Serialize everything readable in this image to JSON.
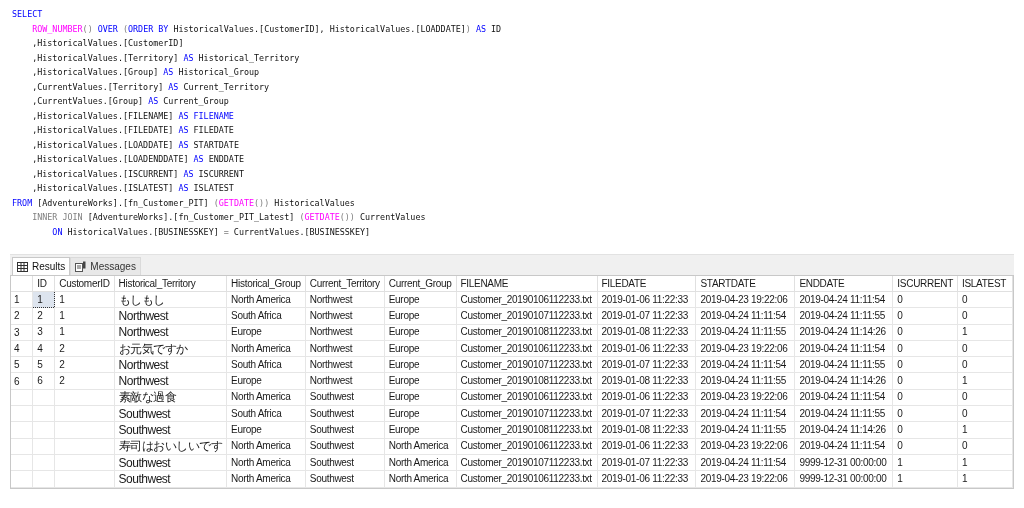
{
  "editor": {
    "lines": [
      [
        {
          "kind": "keyword",
          "text": "SELECT"
        }
      ],
      [
        {
          "kind": "function",
          "text": "    ROW_NUMBER"
        },
        {
          "kind": "operator",
          "text": "() "
        },
        {
          "kind": "keyword",
          "text": "OVER "
        },
        {
          "kind": "operator",
          "text": "("
        },
        {
          "kind": "keyword",
          "text": "ORDER BY"
        },
        {
          "kind": "plain",
          "text": " HistoricalValues.[CustomerID], HistoricalValues.[LOADDATE]"
        },
        {
          "kind": "operator",
          "text": ") "
        },
        {
          "kind": "keyword",
          "text": "AS"
        },
        {
          "kind": "plain",
          "text": " ID"
        }
      ],
      [
        {
          "kind": "plain",
          "text": "    ,HistoricalValues.[CustomerID]"
        }
      ],
      [
        {
          "kind": "plain",
          "text": "    ,HistoricalValues.[Territory] "
        },
        {
          "kind": "keyword",
          "text": "AS"
        },
        {
          "kind": "plain",
          "text": " Historical_Territory"
        }
      ],
      [
        {
          "kind": "plain",
          "text": "    ,HistoricalValues.[Group] "
        },
        {
          "kind": "keyword",
          "text": "AS"
        },
        {
          "kind": "plain",
          "text": " Historical_Group"
        }
      ],
      [
        {
          "kind": "plain",
          "text": "    ,CurrentValues.[Territory] "
        },
        {
          "kind": "keyword",
          "text": "AS"
        },
        {
          "kind": "plain",
          "text": " Current_Territory"
        }
      ],
      [
        {
          "kind": "plain",
          "text": "    ,CurrentValues.[Group] "
        },
        {
          "kind": "keyword",
          "text": "AS"
        },
        {
          "kind": "plain",
          "text": " Current_Group"
        }
      ],
      [
        {
          "kind": "plain",
          "text": "    ,HistoricalValues.[FILENAME] "
        },
        {
          "kind": "keyword",
          "text": "AS FILENAME"
        }
      ],
      [
        {
          "kind": "plain",
          "text": "    ,HistoricalValues.[FILEDATE] "
        },
        {
          "kind": "keyword",
          "text": "AS"
        },
        {
          "kind": "plain",
          "text": " FILEDATE"
        }
      ],
      [
        {
          "kind": "plain",
          "text": "    ,HistoricalValues.[LOADDATE] "
        },
        {
          "kind": "keyword",
          "text": "AS"
        },
        {
          "kind": "plain",
          "text": " STARTDATE"
        }
      ],
      [
        {
          "kind": "plain",
          "text": "    ,HistoricalValues.[LOADENDDATE] "
        },
        {
          "kind": "keyword",
          "text": "AS"
        },
        {
          "kind": "plain",
          "text": " ENDDATE"
        }
      ],
      [
        {
          "kind": "plain",
          "text": "    ,HistoricalValues.[ISCURRENT] "
        },
        {
          "kind": "keyword",
          "text": "AS"
        },
        {
          "kind": "plain",
          "text": " ISCURRENT"
        }
      ],
      [
        {
          "kind": "plain",
          "text": "    ,HistoricalValues.[ISLATEST] "
        },
        {
          "kind": "keyword",
          "text": "AS"
        },
        {
          "kind": "plain",
          "text": " ISLATEST"
        }
      ],
      [
        {
          "kind": "keyword",
          "text": "FROM"
        },
        {
          "kind": "plain",
          "text": " [AdventureWorks].[fn_Customer_PIT] "
        },
        {
          "kind": "operator",
          "text": "("
        },
        {
          "kind": "function",
          "text": "GETDATE"
        },
        {
          "kind": "operator",
          "text": "())"
        },
        {
          "kind": "plain",
          "text": " HistoricalValues"
        }
      ],
      [
        {
          "kind": "operator",
          "text": "    INNER JOIN"
        },
        {
          "kind": "plain",
          "text": " [AdventureWorks].[fn_Customer_PIT_Latest] "
        },
        {
          "kind": "operator",
          "text": "("
        },
        {
          "kind": "function",
          "text": "GETDATE"
        },
        {
          "kind": "operator",
          "text": "())"
        },
        {
          "kind": "plain",
          "text": " CurrentValues"
        }
      ],
      [
        {
          "kind": "keyword",
          "text": "        ON"
        },
        {
          "kind": "plain",
          "text": " HistoricalValues.[BUSINESSKEY] "
        },
        {
          "kind": "operator",
          "text": "="
        },
        {
          "kind": "plain",
          "text": " CurrentValues.[BUSINESSKEY]"
        }
      ]
    ]
  },
  "results": {
    "tabs": [
      {
        "label": "Results",
        "selected": true
      },
      {
        "label": "Messages",
        "selected": false
      }
    ],
    "columns": [
      "ID",
      "CustomerID",
      "Historical_Territory",
      "Historical_Group",
      "Current_Territory",
      "Current_Group",
      "FILENAME",
      "FILEDATE",
      "STARTDATE",
      "ENDDATE",
      "ISCURRENT",
      "ISLATEST"
    ],
    "rows": [
      {
        "row_number": "1",
        "selected": true,
        "cells": [
          "1",
          "1",
          "もしもし",
          "North America",
          "Northwest",
          "Europe",
          "Customer_20190106112233.txt",
          "2019-01-06 11:22:33",
          "2019-04-23 19:22:06",
          "2019-04-24 11:11:54",
          "0",
          "0"
        ]
      },
      {
        "row_number": "2",
        "selected": false,
        "cells": [
          "2",
          "1",
          "Northwest",
          "South Africa",
          "Northwest",
          "Europe",
          "Customer_20190107112233.txt",
          "2019-01-07 11:22:33",
          "2019-04-24 11:11:54",
          "2019-04-24 11:11:55",
          "0",
          "0"
        ]
      },
      {
        "row_number": "3",
        "selected": false,
        "cells": [
          "3",
          "1",
          "Northwest",
          "Europe",
          "Northwest",
          "Europe",
          "Customer_20190108112233.txt",
          "2019-01-08 11:22:33",
          "2019-04-24 11:11:55",
          "2019-04-24 11:14:26",
          "0",
          "1"
        ]
      },
      {
        "row_number": "4",
        "selected": false,
        "cells": [
          "4",
          "2",
          "お元気ですか",
          "North America",
          "Northwest",
          "Europe",
          "Customer_20190106112233.txt",
          "2019-01-06 11:22:33",
          "2019-04-23 19:22:06",
          "2019-04-24 11:11:54",
          "0",
          "0"
        ]
      },
      {
        "row_number": "5",
        "selected": false,
        "cells": [
          "5",
          "2",
          "Northwest",
          "South Africa",
          "Northwest",
          "Europe",
          "Customer_20190107112233.txt",
          "2019-01-07 11:22:33",
          "2019-04-24 11:11:54",
          "2019-04-24 11:11:55",
          "0",
          "0"
        ]
      },
      {
        "row_number": "6",
        "selected": false,
        "cells": [
          "6",
          "2",
          "Northwest",
          "Europe",
          "Northwest",
          "Europe",
          "Customer_20190108112233.txt",
          "2019-01-08 11:22:33",
          "2019-04-24 11:11:55",
          "2019-04-24 11:14:26",
          "0",
          "1"
        ]
      },
      {
        "selected": false,
        "cells": [
          null,
          null,
          "素敵な過食",
          "North America",
          "Southwest",
          "Europe",
          "Customer_20190106112233.txt",
          "2019-01-06 11:22:33",
          "2019-04-23 19:22:06",
          "2019-04-24 11:11:54",
          "0",
          "0"
        ]
      },
      {
        "selected": false,
        "cells": [
          null,
          null,
          "Southwest",
          "South Africa",
          "Southwest",
          "Europe",
          "Customer_20190107112233.txt",
          "2019-01-07 11:22:33",
          "2019-04-24 11:11:54",
          "2019-04-24 11:11:55",
          "0",
          "0"
        ]
      },
      {
        "selected": false,
        "cells": [
          null,
          null,
          "Southwest",
          "Europe",
          "Southwest",
          "Europe",
          "Customer_20190108112233.txt",
          "2019-01-08 11:22:33",
          "2019-04-24 11:11:55",
          "2019-04-24 11:14:26",
          "0",
          "1"
        ]
      },
      {
        "selected": false,
        "cells": [
          null,
          null,
          "寿司はおいしいです",
          "North America",
          "Southwest",
          "North America",
          "Customer_20190106112233.txt",
          "2019-01-06 11:22:33",
          "2019-04-23 19:22:06",
          "2019-04-24 11:11:54",
          "0",
          "0"
        ]
      },
      {
        "selected": false,
        "cells": [
          null,
          null,
          "Southwest",
          "North America",
          "Southwest",
          "North America",
          "Customer_20190107112233.txt",
          "2019-01-07 11:22:33",
          "2019-04-24 11:11:54",
          "9999-12-31 00:00:00",
          "1",
          "1"
        ]
      },
      {
        "selected": false,
        "cells": [
          null,
          null,
          "Southwest",
          "North America",
          "Southwest",
          "North America",
          "Customer_20190106112233.txt",
          "2019-01-06 11:22:33",
          "2019-04-23 19:22:06",
          "9999-12-31 00:00:00",
          "1",
          "1"
        ]
      }
    ]
  }
}
